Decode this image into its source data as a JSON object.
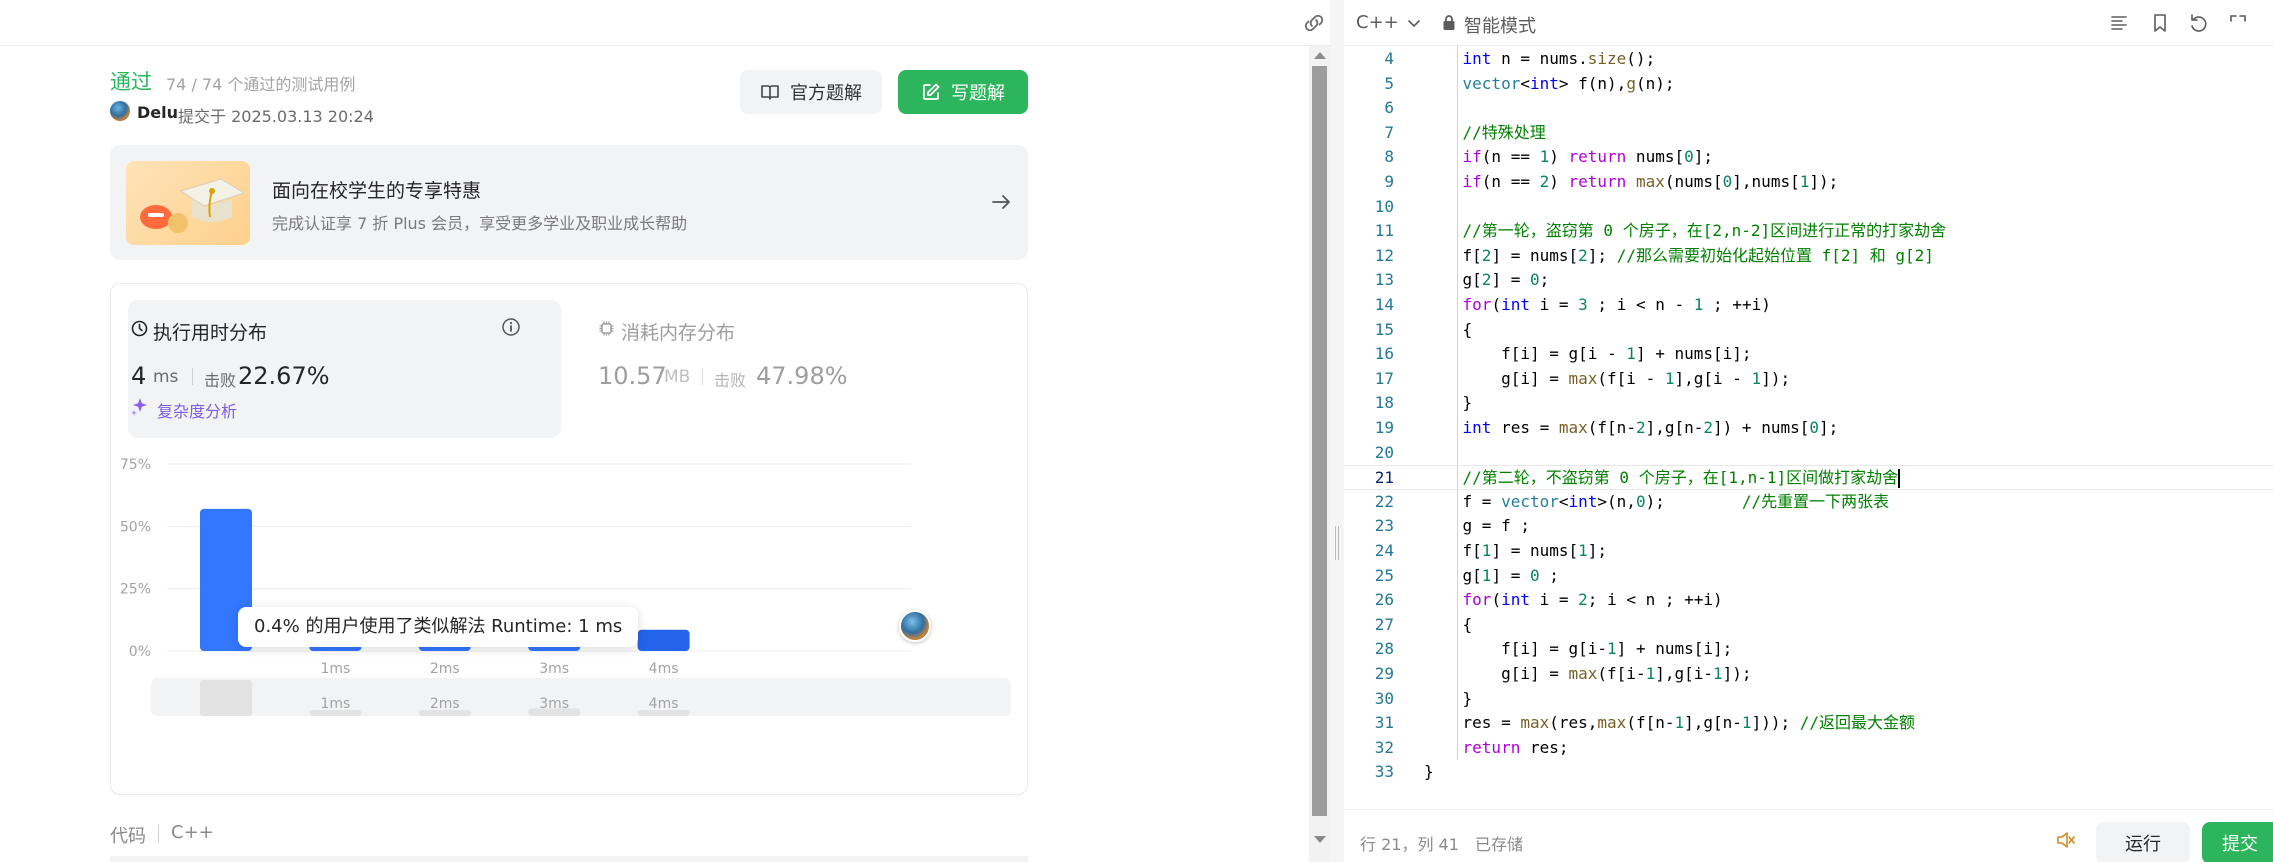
{
  "submission": {
    "status": "通过",
    "cases": "74 / 74 个通过的测试用例",
    "user": "Delu",
    "submit_time": "提交于 2025.03.13 20:24",
    "btn_official": "官方题解",
    "btn_write": "写题解"
  },
  "promo": {
    "title": "面向在校学生的专享特惠",
    "subtitle": "完成认证享 7 折 Plus 会员，享受更多学业及职业成长帮助"
  },
  "runtime": {
    "title": "执行用时分布",
    "value": "4",
    "unit": "ms",
    "beats_label": "击败",
    "beats_value": "22.67%",
    "complexity_link": "复杂度分析"
  },
  "memory": {
    "title": "消耗内存分布",
    "value": "10.57",
    "unit": "MB",
    "beats_label": "击败",
    "beats_value": "47.98%"
  },
  "chart_data": {
    "type": "bar",
    "categories": [
      "",
      "1ms",
      "2ms",
      "3ms",
      "4ms"
    ],
    "values": [
      57,
      2.5,
      6,
      12,
      8.5
    ],
    "ylim": [
      0,
      75
    ],
    "yticks": [
      "75%",
      "50%",
      "25%",
      "0%"
    ],
    "ytick_values": [
      75,
      50,
      25,
      0
    ],
    "highlight_index": 4,
    "bar_color": "#3377ff",
    "highlight_color": "#2563eb",
    "grid": true,
    "mini_labels": [
      "",
      "1ms",
      "2ms",
      "3ms",
      "4ms"
    ],
    "tooltip": "0.4% 的用户使用了类似解法 Runtime: 1 ms"
  },
  "code_section": {
    "label": "代码",
    "lang": "C++"
  },
  "editor": {
    "language": "C++",
    "mode": "智能模式",
    "cursor_pos": "行 21，列 41",
    "saved": "已存储",
    "run": "运行",
    "submit": "提交",
    "lines": [
      {
        "n": "4",
        "c": "    int n = nums.size();"
      },
      {
        "n": "5",
        "c": "    vector<int> f(n),g(n);"
      },
      {
        "n": "6",
        "c": ""
      },
      {
        "n": "7",
        "c": "    //特殊处理"
      },
      {
        "n": "8",
        "c": "    if(n == 1) return nums[0];"
      },
      {
        "n": "9",
        "c": "    if(n == 2) return max(nums[0],nums[1]);"
      },
      {
        "n": "10",
        "c": ""
      },
      {
        "n": "11",
        "c": "    //第一轮，盗窃第 0 个房子，在[2,n-2]区间进行正常的打家劫舍"
      },
      {
        "n": "12",
        "c": "    f[2] = nums[2]; //那么需要初始化起始位置 f[2] 和 g[2]"
      },
      {
        "n": "13",
        "c": "    g[2] = 0;"
      },
      {
        "n": "14",
        "c": "    for(int i = 3 ; i < n - 1 ; ++i)"
      },
      {
        "n": "15",
        "c": "    {"
      },
      {
        "n": "16",
        "c": "        f[i] = g[i - 1] + nums[i];"
      },
      {
        "n": "17",
        "c": "        g[i] = max(f[i - 1],g[i - 1]);"
      },
      {
        "n": "18",
        "c": "    }"
      },
      {
        "n": "19",
        "c": "    int res = max(f[n-2],g[n-2]) + nums[0];"
      },
      {
        "n": "20",
        "c": ""
      },
      {
        "n": "21",
        "c": "    //第二轮，不盗窃第 0 个房子，在[1,n-1]区间做打家劫舍"
      },
      {
        "n": "22",
        "c": "    f = vector<int>(n,0);        //先重置一下两张表"
      },
      {
        "n": "23",
        "c": "    g = f ;"
      },
      {
        "n": "24",
        "c": "    f[1] = nums[1];"
      },
      {
        "n": "25",
        "c": "    g[1] = 0 ;"
      },
      {
        "n": "26",
        "c": "    for(int i = 2; i < n ; ++i)"
      },
      {
        "n": "27",
        "c": "    {"
      },
      {
        "n": "28",
        "c": "        f[i] = g[i-1] + nums[i];"
      },
      {
        "n": "29",
        "c": "        g[i] = max(f[i-1],g[i-1]);"
      },
      {
        "n": "30",
        "c": "    }"
      },
      {
        "n": "31",
        "c": "    res = max(res,max(f[n-1],g[n-1])); //返回最大金额"
      },
      {
        "n": "32",
        "c": "    return res;"
      },
      {
        "n": "33",
        "c": "}"
      }
    ],
    "active_line": 21
  }
}
